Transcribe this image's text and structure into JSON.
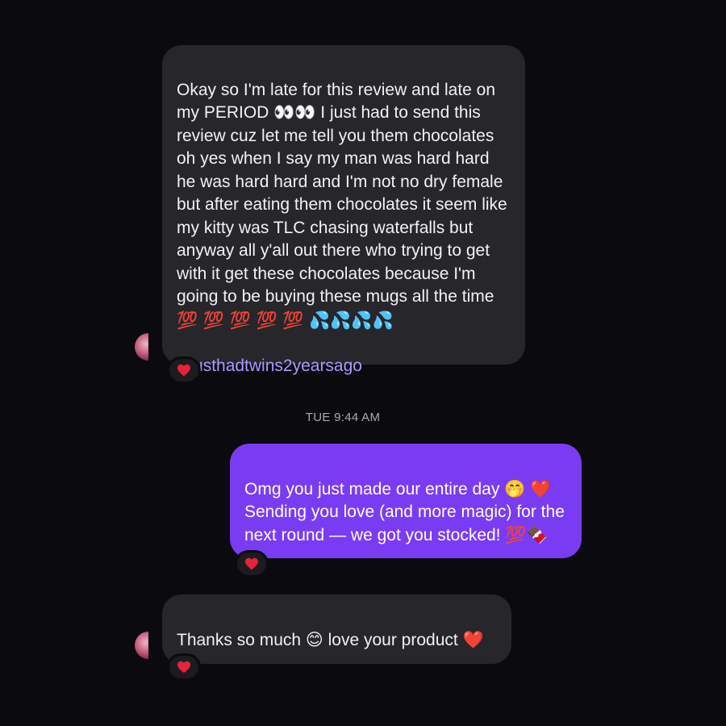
{
  "messages": [
    {
      "sender": "them",
      "text": "Okay so I'm late for this review and late on my PERIOD 👀👀 I just had to send this review cuz let me tell you them chocolates oh yes when I say my man was hard hard he was hard hard and I'm not no dry female but after eating them chocolates it seem like my kitty was TLC chasing waterfalls but anyway  all y'all out there who trying to get with it get these chocolates because I'm going to be buying these mugs all the time",
      "emoji_line": "💯 💯 💯 💯 💯 💦💦💦💦",
      "hashtag": "#ijusthadtwins2yearsago",
      "reaction": "❤️"
    },
    {
      "timestamp": "TUE 9:44 AM"
    },
    {
      "sender": "me",
      "text": "Omg you just made our entire day 🤭 ❤️ Sending you love (and more magic) for the next round — we got you stocked! 💯🍫",
      "reaction": "❤️"
    },
    {
      "sender": "them",
      "text": "Thanks so much 😊 love your product ❤️",
      "reaction": "❤️"
    }
  ],
  "colors": {
    "background": "#0b0b0f",
    "incoming_bubble": "#26262b",
    "outgoing_bubble": "#7a3cf2",
    "hashtag": "#a79bff",
    "timestamp": "#a9a9b0"
  },
  "icons": {
    "avatar": "contact-avatar",
    "reaction": "heart-icon"
  }
}
